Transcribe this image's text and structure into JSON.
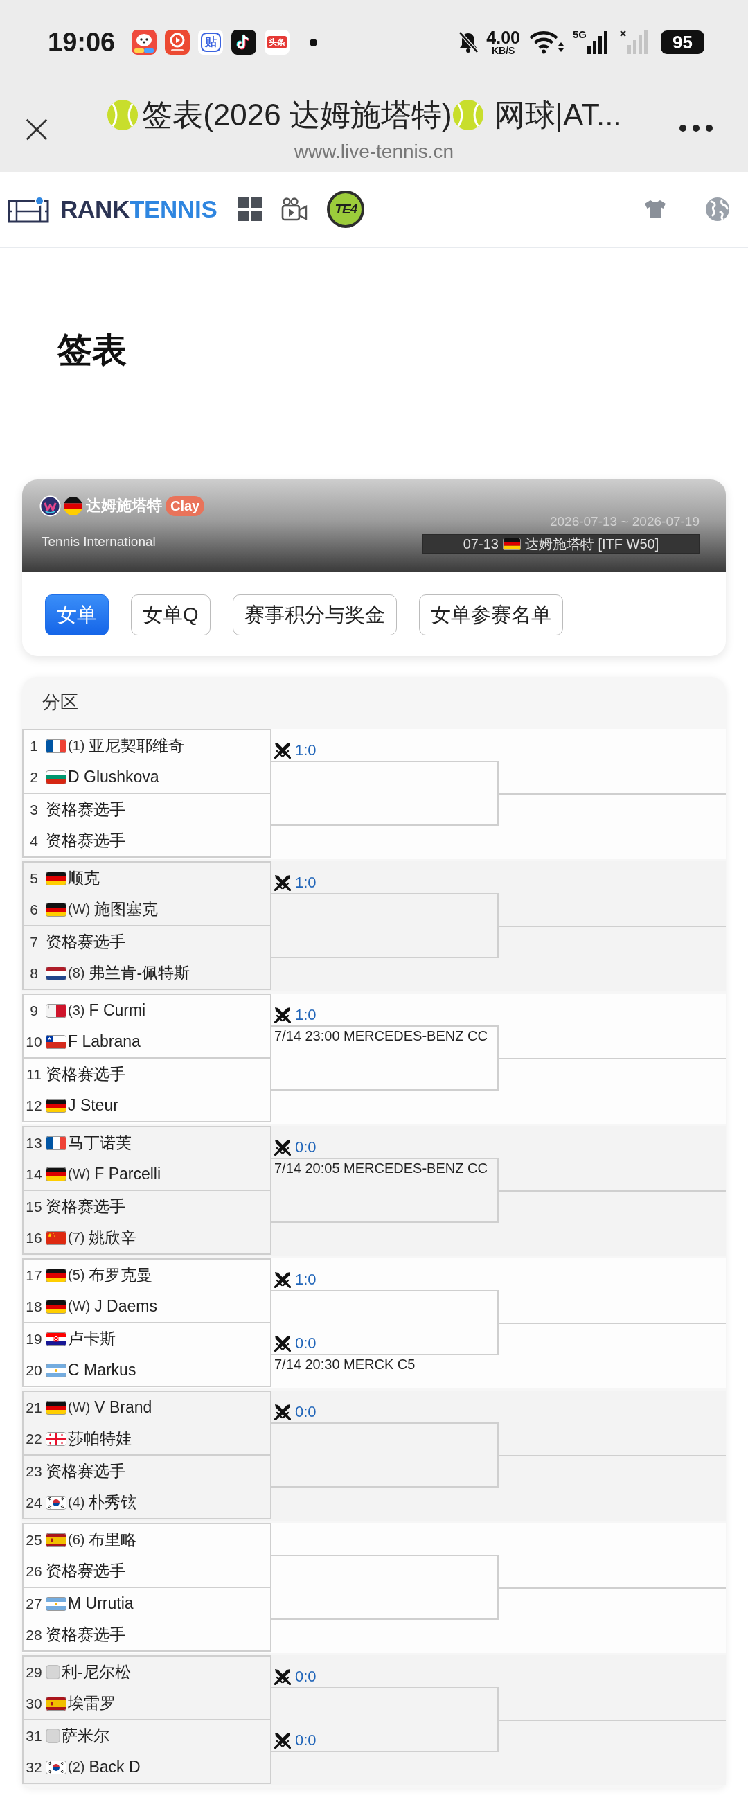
{
  "status_bar": {
    "time": "19:06",
    "app_icons": [
      {
        "kind": "dog"
      },
      {
        "kind": "video"
      },
      {
        "kind": "post",
        "label": "贴"
      },
      {
        "kind": "music"
      },
      {
        "kind": "news",
        "label": "头条"
      }
    ],
    "net_speed": "4.00",
    "net_speed_unit": "KB/S",
    "network_type": "5G",
    "battery": "95"
  },
  "browser_bar": {
    "title": [
      {
        "kind": "ball"
      },
      {
        "kind": "text",
        "text": "签表(2026 达姆施塔特)"
      },
      {
        "kind": "ball"
      },
      {
        "kind": "text",
        "text": "网球|AT..."
      }
    ],
    "url": "www.live-tennis.cn"
  },
  "site_nav": {
    "brand": [
      "RANK",
      "TENNIS"
    ],
    "badge": "TE4"
  },
  "page_title": "签表",
  "tournament": {
    "flag": {
      "kind": "de"
    },
    "name": "达姆施塔特",
    "surface": "Clay",
    "dates": "2026-07-13 ~ 2026-07-19",
    "category": "Tennis International",
    "event": {
      "date": "07-13",
      "flag": {
        "kind": "de"
      },
      "name": "达姆施塔特 [ITF W50]"
    }
  },
  "tabs": [
    {
      "label": "女单",
      "selected": true
    },
    {
      "label": "女单Q",
      "selected": false
    },
    {
      "label": "赛事积分与奖金",
      "selected": false
    },
    {
      "label": "女单参赛名单",
      "selected": false
    }
  ],
  "draw": {
    "title": "分区",
    "groups": [
      {
        "matches": [
          {
            "players": [
              {
                "number": "1",
                "flag": {
                  "kind": "fr"
                },
                "seed": "(1)",
                "name": "亚尼契耶维奇"
              },
              {
                "number": "2",
                "flag": {
                  "kind": "bg"
                },
                "name": "D Glushkova"
              }
            ],
            "score": "1:0"
          },
          {
            "players": [
              {
                "number": "3",
                "name": "资格赛选手"
              },
              {
                "number": "4",
                "name": "资格赛选手"
              }
            ]
          }
        ]
      },
      {
        "matches": [
          {
            "players": [
              {
                "number": "5",
                "flag": {
                  "kind": "de"
                },
                "name": "顺克"
              },
              {
                "number": "6",
                "flag": {
                  "kind": "de"
                },
                "seed": "(W)",
                "name": "施图塞克"
              }
            ],
            "score": "1:0"
          },
          {
            "players": [
              {
                "number": "7",
                "name": "资格赛选手"
              },
              {
                "number": "8",
                "flag": {
                  "kind": "nl"
                },
                "seed": "(8)",
                "name": "弗兰肯-佩特斯"
              }
            ]
          }
        ]
      },
      {
        "matches": [
          {
            "players": [
              {
                "number": "9",
                "flag": {
                  "kind": "mt"
                },
                "seed": "(3)",
                "name": "F Curmi"
              },
              {
                "number": "10",
                "flag": {
                  "kind": "cl"
                },
                "name": "F Labrana"
              }
            ],
            "score": "1:0",
            "schedule": "7/14 23:00 MERCEDES-BENZ CC"
          },
          {
            "players": [
              {
                "number": "11",
                "name": "资格赛选手"
              },
              {
                "number": "12",
                "flag": {
                  "kind": "de"
                },
                "name": "J Steur"
              }
            ]
          }
        ]
      },
      {
        "matches": [
          {
            "players": [
              {
                "number": "13",
                "flag": {
                  "kind": "fr"
                },
                "name": "马丁诺芙"
              },
              {
                "number": "14",
                "flag": {
                  "kind": "de"
                },
                "seed": "(W)",
                "name": "F Parcelli"
              }
            ],
            "score": "0:0",
            "schedule": "7/14 20:05 MERCEDES-BENZ CC"
          },
          {
            "players": [
              {
                "number": "15",
                "name": "资格赛选手"
              },
              {
                "number": "16",
                "flag": {
                  "kind": "cn"
                },
                "seed": "(7)",
                "name": "姚欣辛"
              }
            ]
          }
        ]
      },
      {
        "matches": [
          {
            "players": [
              {
                "number": "17",
                "flag": {
                  "kind": "de"
                },
                "seed": "(5)",
                "name": "布罗克曼"
              },
              {
                "number": "18",
                "flag": {
                  "kind": "de"
                },
                "seed": "(W)",
                "name": "J Daems"
              }
            ],
            "score": "1:0"
          },
          {
            "players": [
              {
                "number": "19",
                "flag": {
                  "kind": "hr"
                },
                "name": "卢卡斯"
              },
              {
                "number": "20",
                "flag": {
                  "kind": "ar"
                },
                "name": "C Markus"
              }
            ],
            "score": "0:0",
            "schedule": "7/14 20:30 MERCK C5"
          }
        ]
      },
      {
        "matches": [
          {
            "players": [
              {
                "number": "21",
                "flag": {
                  "kind": "de"
                },
                "seed": "(W)",
                "name": "V Brand"
              },
              {
                "number": "22",
                "flag": {
                  "kind": "ge"
                },
                "name": "莎帕特娃"
              }
            ],
            "score": "0:0"
          },
          {
            "players": [
              {
                "number": "23",
                "name": "资格赛选手"
              },
              {
                "number": "24",
                "flag": {
                  "kind": "kr"
                },
                "seed": "(4)",
                "name": "朴秀铉"
              }
            ]
          }
        ]
      },
      {
        "matches": [
          {
            "players": [
              {
                "number": "25",
                "flag": {
                  "kind": "es"
                },
                "seed": "(6)",
                "name": "布里略"
              },
              {
                "number": "26",
                "name": "资格赛选手"
              }
            ]
          },
          {
            "players": [
              {
                "number": "27",
                "flag": {
                  "kind": "ar"
                },
                "name": "M Urrutia"
              },
              {
                "number": "28",
                "name": "资格赛选手"
              }
            ]
          }
        ]
      },
      {
        "matches": [
          {
            "players": [
              {
                "number": "29",
                "flag": {
                  "kind": "blank"
                },
                "name": "利-尼尔松"
              },
              {
                "number": "30",
                "flag": {
                  "kind": "es"
                },
                "name": "埃雷罗"
              }
            ],
            "score": "0:0"
          },
          {
            "players": [
              {
                "number": "31",
                "flag": {
                  "kind": "blank"
                },
                "name": "萨米尔"
              },
              {
                "number": "32",
                "flag": {
                  "kind": "kr"
                },
                "seed": "(2)",
                "name": "Back D"
              }
            ],
            "score": "0:0"
          }
        ]
      }
    ]
  }
}
